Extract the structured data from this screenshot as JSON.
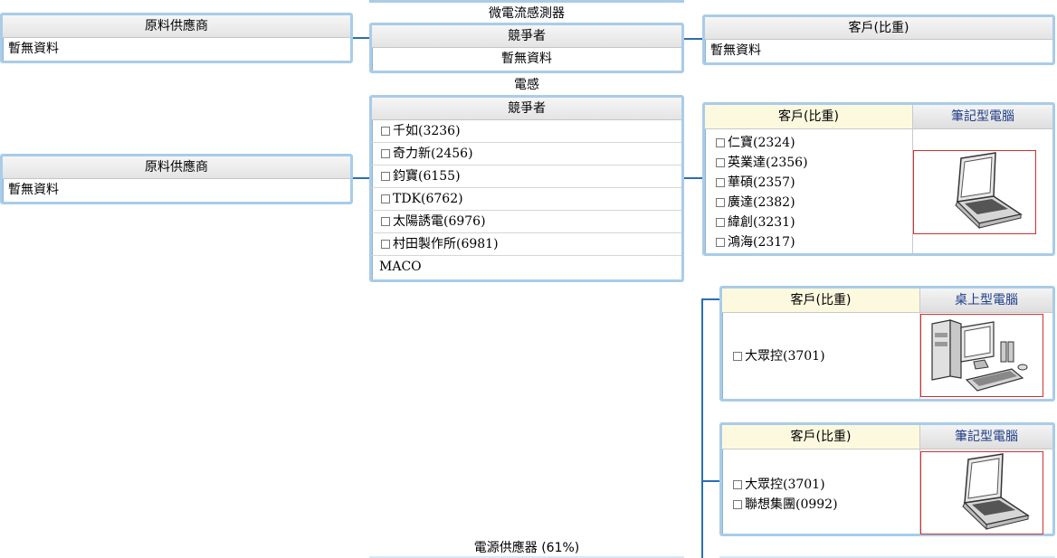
{
  "top_strip_label": "微電流感測器",
  "section1": {
    "supplier": {
      "header": "原料供應商",
      "value": "暫無資料"
    },
    "competitor": {
      "header": "競爭者",
      "value": "暫無資料"
    },
    "customer": {
      "header": "客戶(比重)",
      "value": "暫無資料"
    }
  },
  "section2": {
    "title": "電感",
    "supplier": {
      "header": "原料供應商",
      "value": "暫無資料"
    },
    "competitor": {
      "header": "競爭者",
      "items": [
        "千如(3236)",
        "奇力新(2456)",
        "鈞寶(6155)",
        "TDK(6762)",
        "太陽誘電(6976)",
        "村田製作所(6981)"
      ],
      "last": "MACO"
    },
    "customer_group": {
      "header": "客戶(比重)",
      "product": "筆記型電腦",
      "items": [
        "仁寶(2324)",
        "英業達(2356)",
        "華碩(2357)",
        "廣達(2382)",
        "緯創(3231)",
        "鴻海(2317)"
      ]
    }
  },
  "customer_group2": {
    "header": "客戶(比重)",
    "product": "桌上型電腦",
    "items": [
      "大眾控(3701)"
    ]
  },
  "customer_group3": {
    "header": "客戶(比重)",
    "product": "筆記型電腦",
    "items": [
      "大眾控(3701)",
      "聯想集團(0992)"
    ]
  },
  "bottom_label": "電源供應器 (61%)",
  "colors": {
    "connector": "#2a6fb0",
    "box_border": "#a9cce8",
    "customer_header_bg": "#fdf9df",
    "image_border": "#d03030"
  }
}
